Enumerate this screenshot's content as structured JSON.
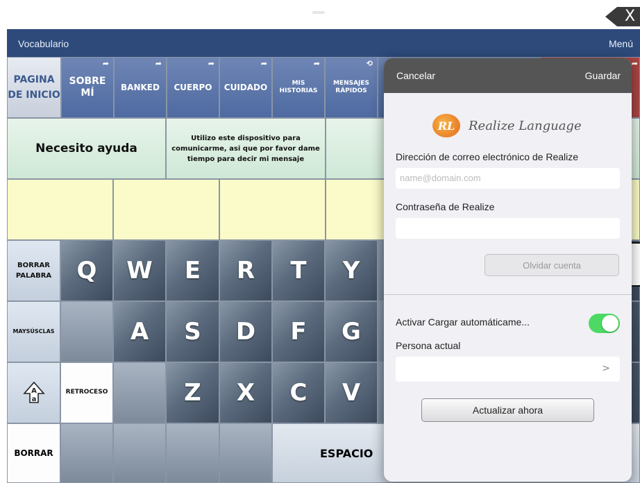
{
  "top": {
    "close_label": "X"
  },
  "nav": {
    "left": "Vocabulario",
    "right": "Menú"
  },
  "tabs": [
    {
      "label": "PAGINA DE INICIO"
    },
    {
      "label": "SOBRE MÍ"
    },
    {
      "label": "BANKED"
    },
    {
      "label": "CUERPO"
    },
    {
      "label": "CUIDADO"
    },
    {
      "label": "MIS HISTORIAS"
    },
    {
      "label": "MENSAJES RÁPIDOS"
    }
  ],
  "phrases": {
    "help": "Necesito ayuda",
    "device": "Utilizo este dispositivo para comunicarme, asi que por favor dame tiempo para decir mi mensaje"
  },
  "keys": {
    "row1": [
      "Q",
      "W",
      "E",
      "R",
      "T",
      "Y"
    ],
    "row2": [
      "A",
      "S",
      "D",
      "F",
      "G"
    ],
    "row3": [
      "Z",
      "X",
      "C",
      "V"
    ]
  },
  "function_keys": {
    "delete_word": "BORRAR PALABRA",
    "shift": "MAYSÚSCLAS",
    "backspace": "RETROCESO",
    "clear": "BORRAR",
    "space": "ESPACIO"
  },
  "popover": {
    "cancel": "Cancelar",
    "save": "Guardar",
    "logo_text": "Realize Language",
    "email_label": "Dirección de correo electrónico de Realize",
    "email_placeholder": "name@domain.com",
    "password_label": "Contraseña de Realize",
    "forget_button": "Olvidar cuenta",
    "autoupload_label": "Activar Cargar automáticame...",
    "autoupload_on": true,
    "persona_label": "Persona actual",
    "update_button": "Actualizar ahora"
  },
  "colors": {
    "nav": "#2d4a7b",
    "toggle_on": "#4cd964",
    "tab": "#5a74a8"
  }
}
